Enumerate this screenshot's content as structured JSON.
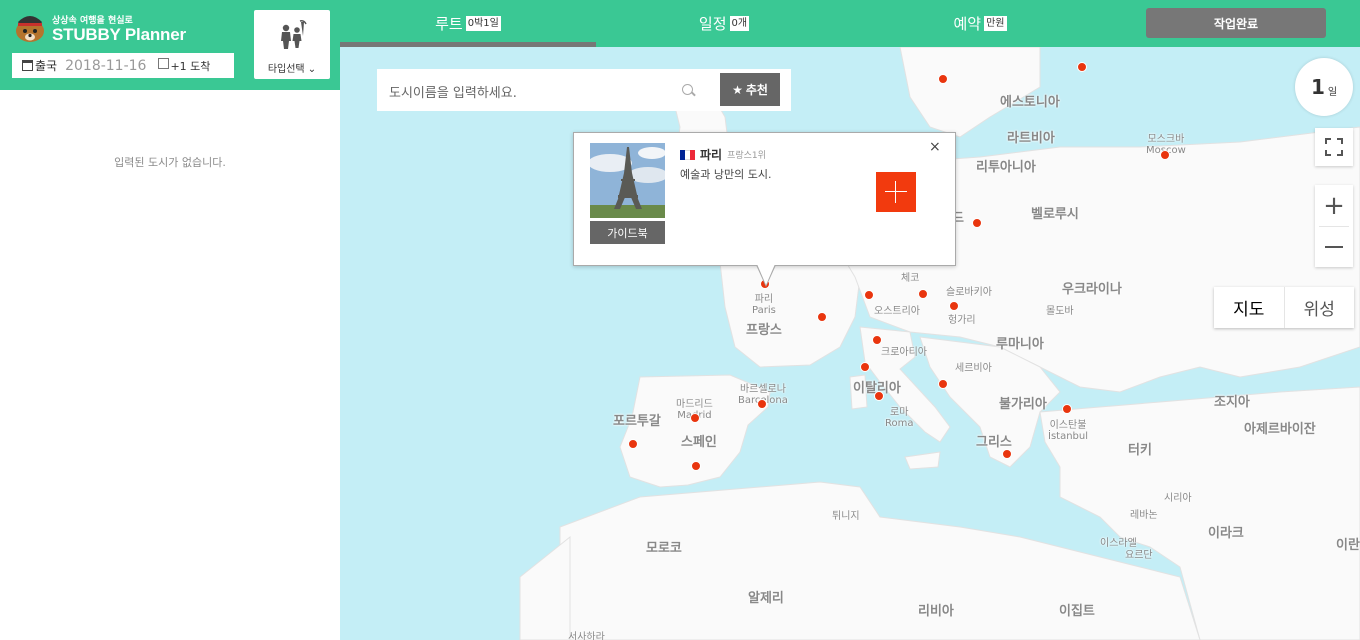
{
  "brand": {
    "tagline": "상상속 여행을 현실로",
    "name": "STUBBY Planner"
  },
  "trip": {
    "departure_label": "출국",
    "departure_date": "2018-11-16",
    "arrive_label": "+1 도착",
    "arrive_checked": false,
    "type_button_label": "타입선택 ⌄",
    "empty_cities_msg": "입력된 도시가 없습니다."
  },
  "tabs": [
    {
      "label": "루트",
      "badge": "0박1일",
      "active": true
    },
    {
      "label": "일정",
      "badge": "0개",
      "active": false
    },
    {
      "label": "예약",
      "badge": "만원",
      "active": false
    }
  ],
  "done_button": "작업완료",
  "search": {
    "placeholder": "도시이름을 입력하세요.",
    "recommend_label": "추천"
  },
  "map": {
    "day_count": "1",
    "day_unit": "일",
    "map_type_options": [
      "지도",
      "위성"
    ],
    "selected_map_type": "지도",
    "labels": {
      "estonia": "에스토니아",
      "latvia": "라트비아",
      "moscow_ko": "모스크바",
      "moscow_en": "Moscow",
      "lithuania": "리투아니아",
      "belarus": "벨로루시",
      "czech": "체코",
      "slovakia": "슬로바키아",
      "ukraine": "우크라이나",
      "moldova": "몰도바",
      "austria": "오스트리아",
      "hungary": "헝가리",
      "paris_ko": "파리",
      "paris_en": "Paris",
      "france": "프랑스",
      "croatia": "크로아티아",
      "romania": "루마니아",
      "serbia": "세르비아",
      "italy": "이탈리아",
      "bulgaria": "불가리아",
      "georgia": "조지아",
      "rome_ko": "로마",
      "rome_en": "Roma",
      "madrid_ko": "마드리드",
      "madrid_en": "Madrid",
      "barcelona_ko": "바르셀로나",
      "barcelona_en": "Barcelona",
      "portugal": "포르투갈",
      "spain": "스페인",
      "istanbul_ko": "이스탄불",
      "istanbul_en": "İstanbul",
      "azerbaijan": "아제르바이잔",
      "greece": "그리스",
      "turkey": "터키",
      "syria": "시리아",
      "tunisia": "튀니지",
      "lebanon": "레바논",
      "iraq": "이라크",
      "israel": "이스라엘",
      "jordan": "요르단",
      "morocco": "모로코",
      "algeria": "알제리",
      "libya": "리비아",
      "egypt": "이집트",
      "sahara": "서사하라",
      "iran_partial": "이란",
      "poland_partial": "드"
    }
  },
  "popup": {
    "city": "파리",
    "rank": "프랑스1위",
    "description": "예술과 낭만의 도시.",
    "guide_label": "가이드북",
    "close": "×",
    "flag_colors": [
      "#002395",
      "#ffffff",
      "#ed2939"
    ]
  },
  "colors": {
    "brand_green": "#3ac894",
    "marker_red": "#e9350e",
    "add_button": "#f23a0e",
    "sea": "#c4eef6"
  }
}
